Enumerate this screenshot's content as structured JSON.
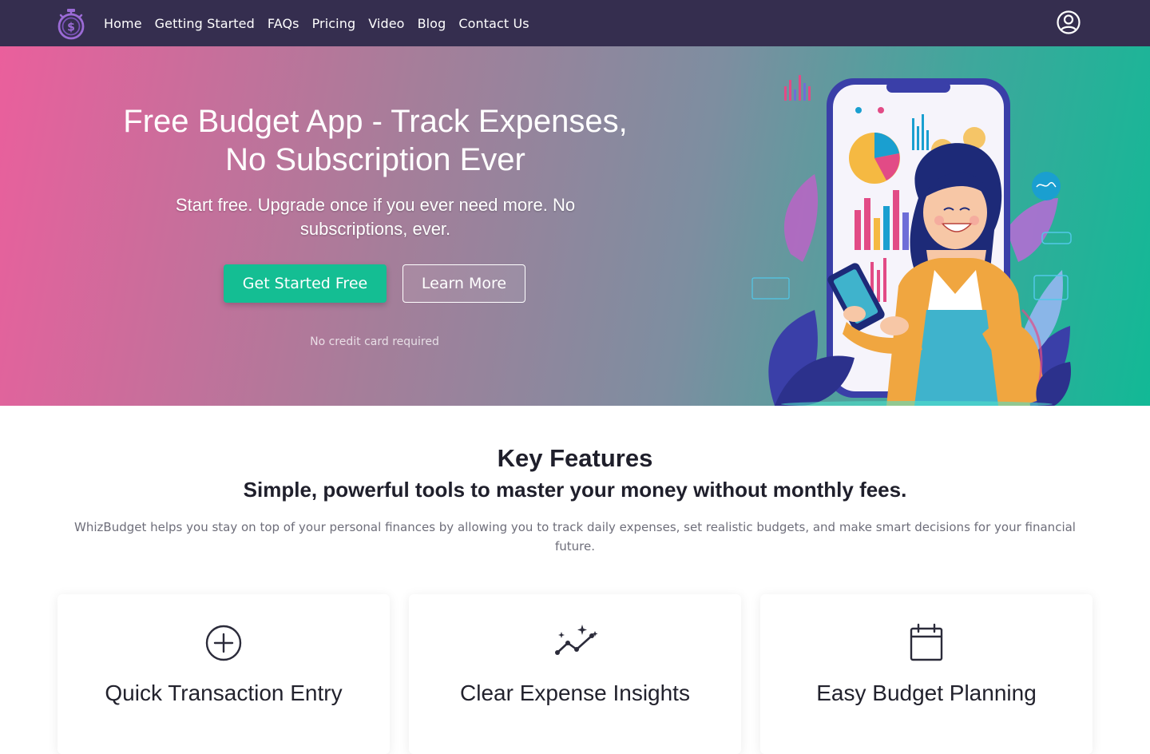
{
  "navbar": {
    "logo_icon": "stopwatch-dollar-icon",
    "links": [
      "Home",
      "Getting Started",
      "FAQs",
      "Pricing",
      "Video",
      "Blog",
      "Contact Us"
    ],
    "user_icon": "user-circle-icon"
  },
  "hero": {
    "title_line1": "Free Budget App - Track Expenses,",
    "title_line2": "No Subscription Ever",
    "subtitle": "Start free. Upgrade once if you ever need more. No subscriptions, ever.",
    "primary_button": "Get Started Free",
    "secondary_button": "Learn More",
    "note": "No credit card required",
    "illustration": "woman-holding-tablet-with-phone-charts-illustration"
  },
  "features": {
    "title": "Key Features",
    "subtitle": "Simple, powerful tools to master your money without monthly fees.",
    "description": "WhizBudget helps you stay on top of your personal finances by allowing you to track daily expenses, set realistic budgets, and make smart decisions for your financial future.",
    "cards": [
      {
        "icon": "plus-circle-icon",
        "title": "Quick Transaction Entry"
      },
      {
        "icon": "sparkle-line-chart-icon",
        "title": "Clear Expense Insights"
      },
      {
        "icon": "calendar-icon",
        "title": "Easy Budget Planning"
      }
    ]
  },
  "colors": {
    "navbar": "#352e4f",
    "accent_green": "#14be93",
    "hero_pink": "#ea5f9c",
    "hero_teal": "#12b996"
  }
}
